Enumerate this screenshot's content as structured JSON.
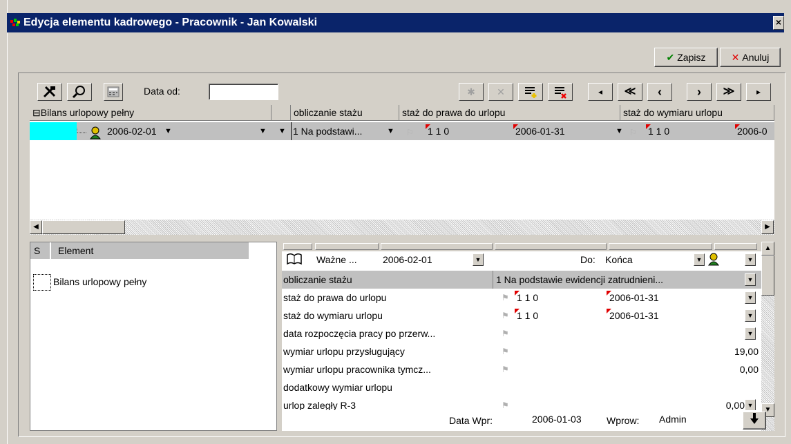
{
  "window": {
    "title": "Edycja elementu kadrowego - Pracownik - Jan Kowalski",
    "close_glyph": "×"
  },
  "actions": {
    "save_label": "Zapisz",
    "save_icon": "✔",
    "cancel_label": "Anuluj",
    "cancel_icon": "✕"
  },
  "toolbar": {
    "date_from_label": "Data od:",
    "date_from_value": "",
    "nav_glyphs": [
      "◂",
      "≪",
      "‹",
      "›",
      "≫",
      "▸"
    ]
  },
  "top_grid": {
    "tree_root": "Bilans urlopowy pełny",
    "expander": "⊟",
    "columns": [
      "obliczanie stażu",
      "staż do prawa do urlopu",
      "staż do wymiaru urlopu"
    ],
    "row": {
      "date": "2006-02-01",
      "calc": "1 Na podstawi...",
      "staz_prawa_ylm": "1  1  0",
      "staz_prawa_date": "2006-01-31",
      "staz_wymiaru_ylm": "1  1  0",
      "staz_wymiaru_date": "2006-0"
    }
  },
  "left_list": {
    "col_s": "S",
    "col_element": "Element",
    "items": [
      "Bilans urlopowy pełny"
    ]
  },
  "props": {
    "valid_label": "Ważne ...",
    "valid_date": "2006-02-01",
    "to_label": "Do:",
    "to_value": "Końca",
    "rows": [
      {
        "name": "obliczanie stażu",
        "value": "1 Na podstawie ewidencji zatrudnieni..."
      },
      {
        "name": "staż do prawa do urlopu",
        "ylm": "1  1  0",
        "date": "2006-01-31"
      },
      {
        "name": "staż do wymiaru urlopu",
        "ylm": "1  1  0",
        "date": "2006-01-31"
      },
      {
        "name": "data rozpoczęcia pracy po przerw..."
      },
      {
        "name": "wymiar urlopu przysługujący",
        "num": "19,00"
      },
      {
        "name": "wymiar urlopu pracownika tymcz...",
        "num": "0,00"
      },
      {
        "name": "dodatkowy wymiar urlopu"
      },
      {
        "name": "urlop zaległy R-3",
        "num": "0,00"
      }
    ]
  },
  "footer": {
    "data_wpr_label": "Data Wpr:",
    "data_wpr_value": "2006-01-03",
    "wprow_label": "Wprow:",
    "wprow_value": "Admin"
  }
}
